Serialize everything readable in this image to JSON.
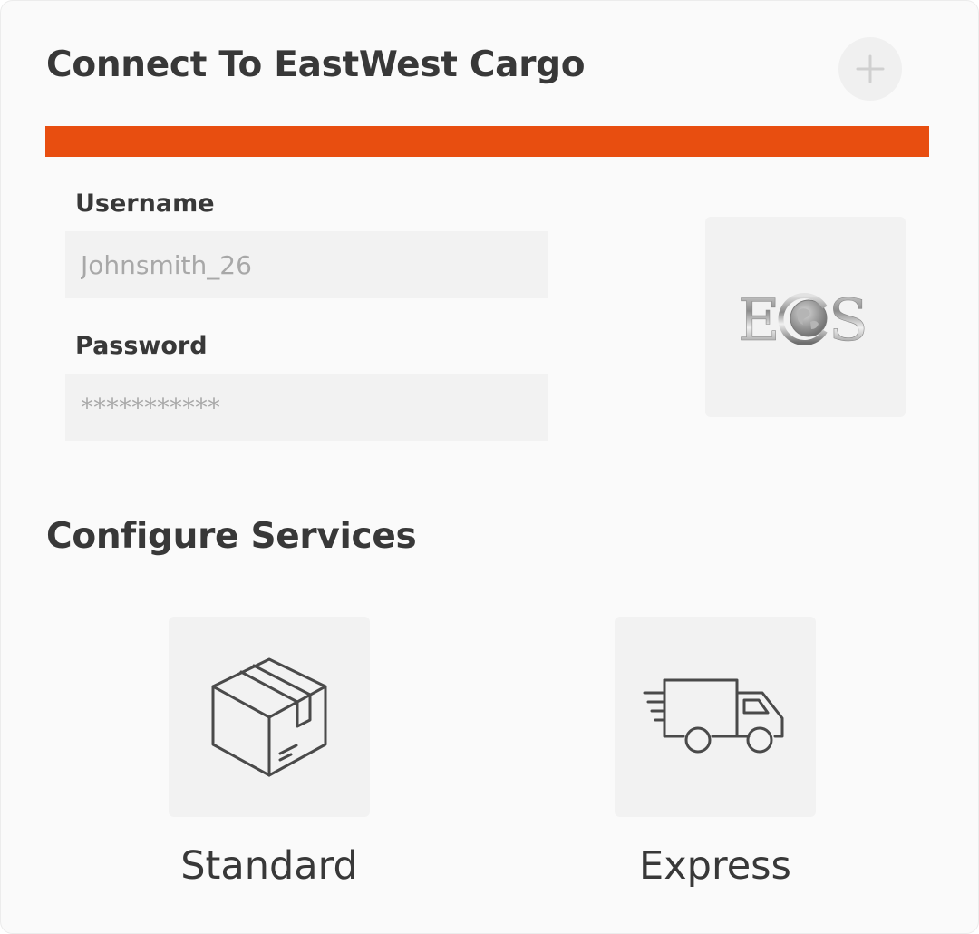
{
  "connect": {
    "title": "Connect To EastWest Cargo",
    "add_icon": "plus-icon",
    "accent_color": "#e84e10"
  },
  "credentials": {
    "username": {
      "label": "Username",
      "value": "Johnsmith_26"
    },
    "password": {
      "label": "Password",
      "value": "***********"
    }
  },
  "logo": {
    "text": "ECS",
    "description_icon": "globe-icon"
  },
  "services": {
    "title": "Configure Services",
    "items": [
      {
        "label": "Standard",
        "icon": "package-box-icon"
      },
      {
        "label": "Express",
        "icon": "delivery-truck-icon"
      }
    ]
  }
}
